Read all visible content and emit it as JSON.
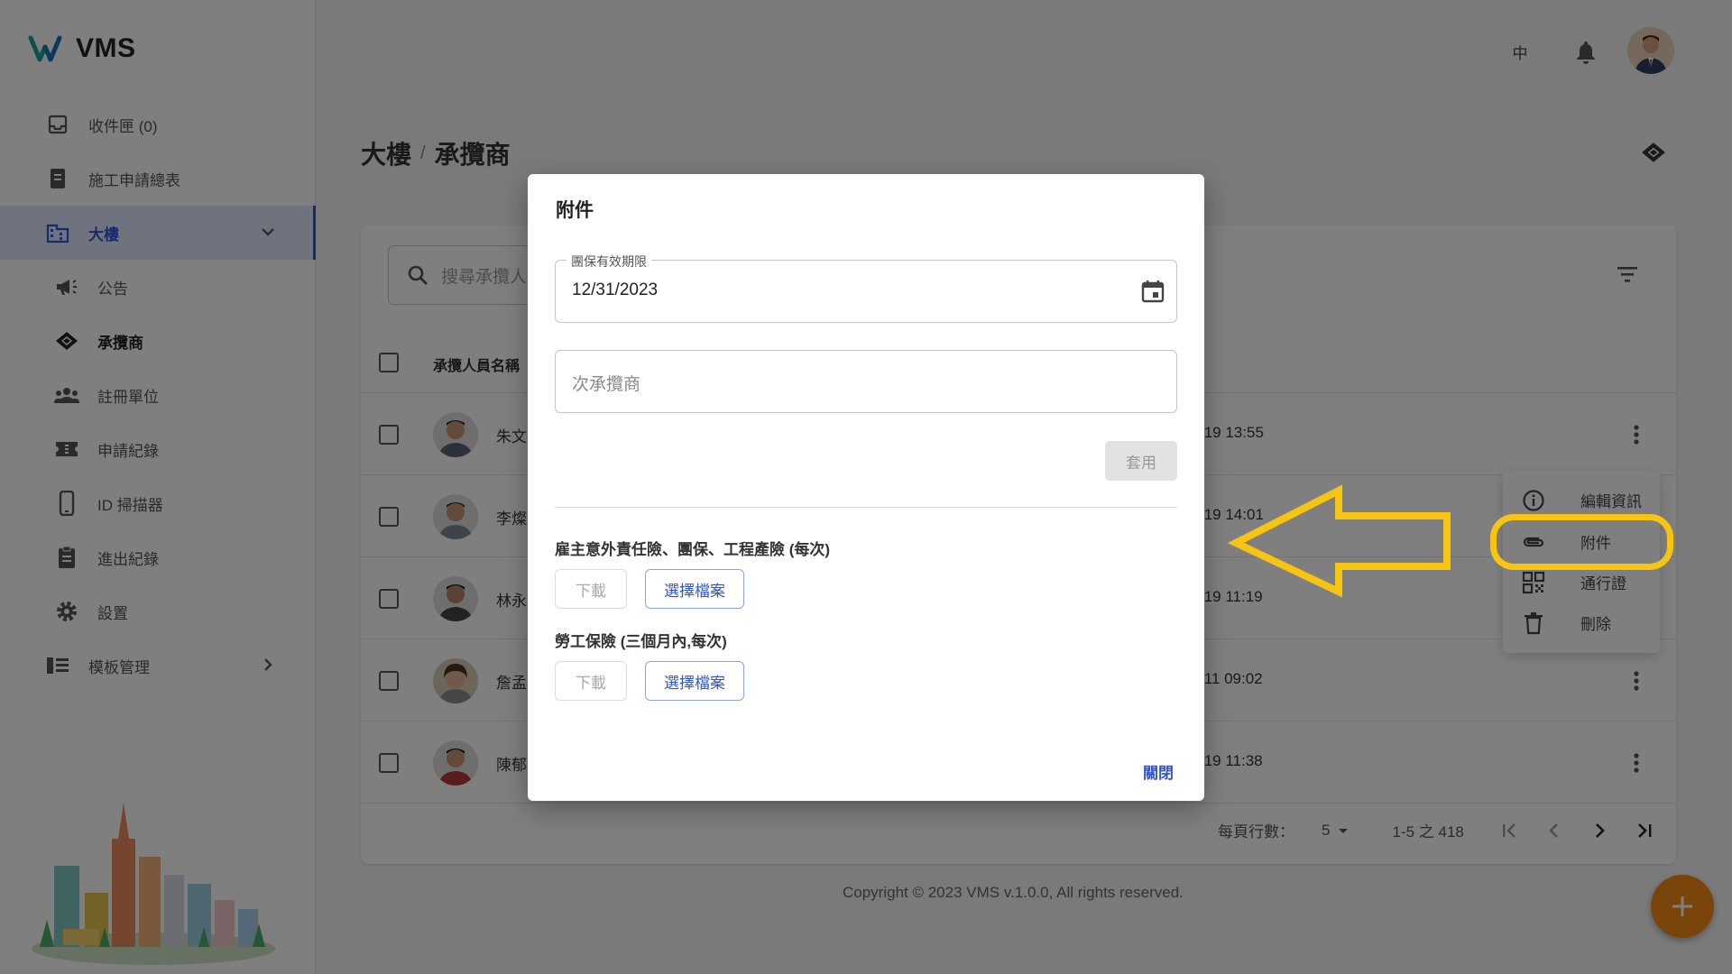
{
  "app": {
    "name": "VMS"
  },
  "sidebar": {
    "items": [
      {
        "label": "收件匣 (0)",
        "icon": "inbox-icon"
      },
      {
        "label": "施工申請總表",
        "icon": "document-icon"
      },
      {
        "label": "大樓",
        "icon": "building-icon"
      },
      {
        "label": "公告",
        "icon": "megaphone-icon"
      },
      {
        "label": "承攬商",
        "icon": "handshake-icon"
      },
      {
        "label": "註冊單位",
        "icon": "group-icon"
      },
      {
        "label": "申請紀錄",
        "icon": "ticket-icon"
      },
      {
        "label": "ID 掃描器",
        "icon": "phone-icon"
      },
      {
        "label": "進出紀錄",
        "icon": "clipboard-icon"
      },
      {
        "label": "設置",
        "icon": "gear-icon"
      },
      {
        "label": "模板管理",
        "icon": "template-icon"
      }
    ]
  },
  "topbar": {
    "lang": "中"
  },
  "breadcrumb": {
    "parent": "大樓",
    "separator": "/",
    "current": "承攬商"
  },
  "search": {
    "placeholder": "搜尋承攬人"
  },
  "table": {
    "header_name": "承攬人員名稱",
    "header_tail": "]",
    "rows": [
      {
        "name": "朱文",
        "time": "/19 13:55"
      },
      {
        "name": "李燦",
        "time": "/19 14:01"
      },
      {
        "name": "林永",
        "time": "/19 11:19"
      },
      {
        "name": "詹孟",
        "time": "/11 09:02"
      },
      {
        "name": "陳郁",
        "time": "/19 11:38"
      }
    ]
  },
  "pagination": {
    "rows_per_page_label": "每頁行數：",
    "rows_per_page": "5",
    "range": "1-5 之 418"
  },
  "copyright": "Copyright © 2023 VMS v.1.0.0, All rights reserved.",
  "context_menu": {
    "items": [
      {
        "label": "編輯資訊",
        "icon": "info-icon"
      },
      {
        "label": "附件",
        "icon": "paperclip-icon"
      },
      {
        "label": "通行證",
        "icon": "qr-code-icon"
      },
      {
        "label": "刪除",
        "icon": "trash-icon"
      }
    ]
  },
  "dialog": {
    "title": "附件",
    "date_field": {
      "label": "團保有效期限",
      "value": "12/31/2023"
    },
    "sub_field": {
      "placeholder": "次承攬商"
    },
    "apply_label": "套用",
    "sections": [
      {
        "label": "雇主意外責任險、團保、工程產險 (每次)",
        "download_label": "下載",
        "choose_label": "選擇檔案"
      },
      {
        "label": "勞工保險 (三個月內,每次)",
        "download_label": "下載",
        "choose_label": "選擇檔案"
      }
    ],
    "close_label": "關閉"
  },
  "colors": {
    "accent": "#2f55d4",
    "annotation": "#f8c413",
    "fab": "#f38b16"
  }
}
